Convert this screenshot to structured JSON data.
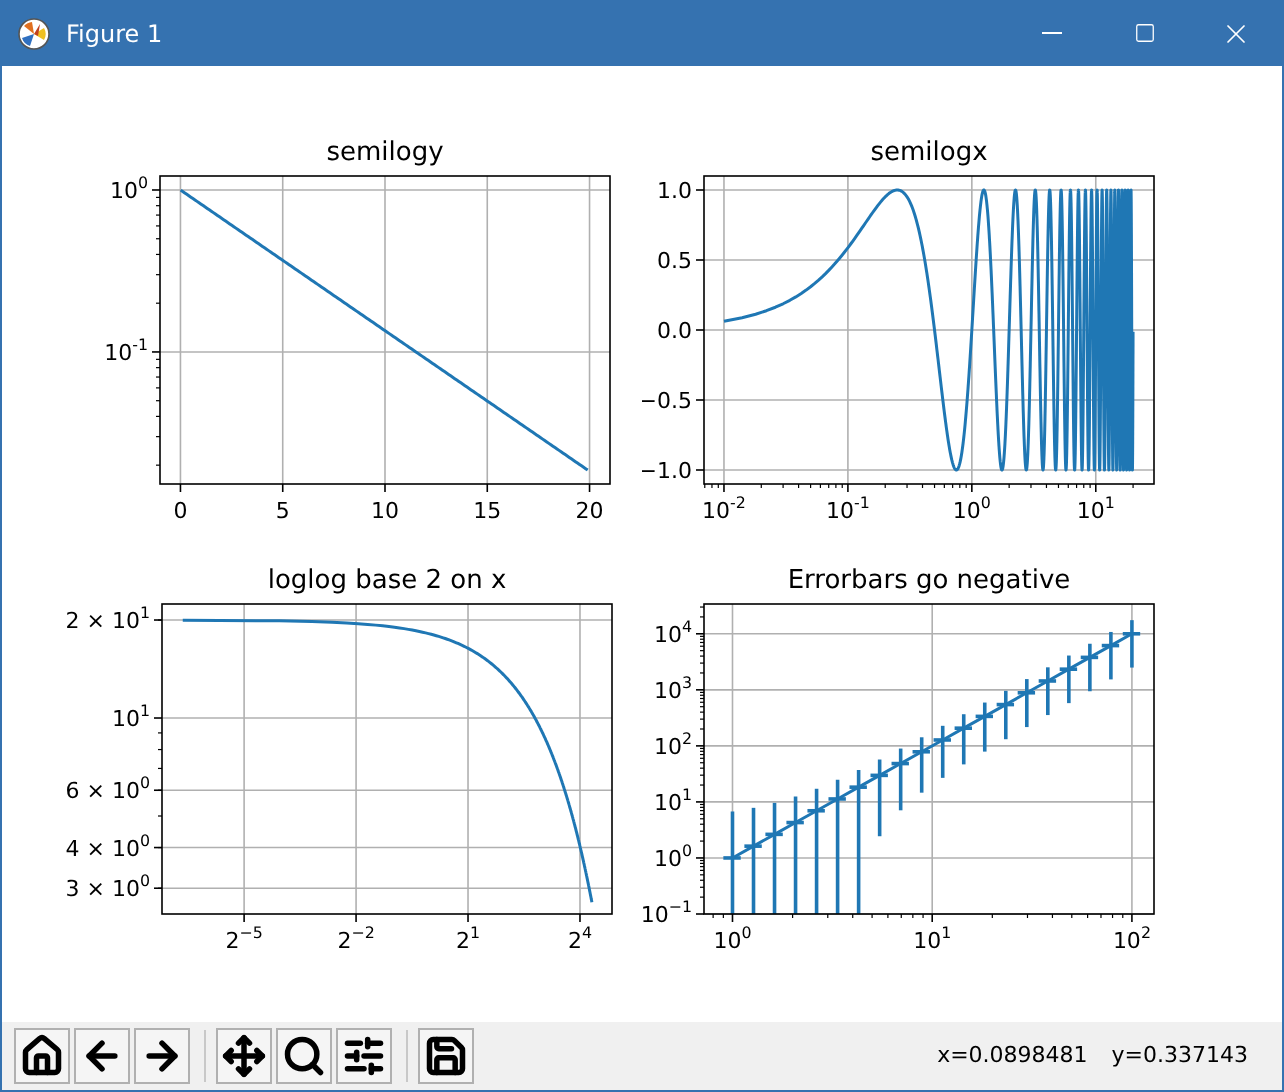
{
  "window": {
    "title": "Figure 1"
  },
  "charts": [
    {
      "title": "semilogy",
      "x_tick_labels": [
        "0",
        "5",
        "10",
        "15",
        "20"
      ],
      "y_tick_labels": [
        "10$^{0}$",
        "10$^{-1}$"
      ]
    },
    {
      "title": "semilogx",
      "x_tick_labels": [
        "10$^{-2}$",
        "10$^{-1}$",
        "10$^{0}$",
        "10$^{1}$"
      ],
      "y_tick_labels": [
        "1.0",
        "0.5",
        "0.0",
        "−0.5",
        "−1.0"
      ]
    },
    {
      "title": "loglog base 2 on x",
      "x_tick_labels": [
        "2$^{−5}$",
        "2$^{−2}$",
        "2$^{1}$",
        "2$^{4}$"
      ],
      "y_tick_labels": [
        "2 × 10$^{1}$",
        "10$^{1}$",
        "6 × 10$^{0}$",
        "4 × 10$^{0}$",
        "3 × 10$^{0}$"
      ]
    },
    {
      "title": "Errorbars go negative",
      "x_tick_labels": [
        "10$^{0}$",
        "10$^{1}$",
        "10$^{2}$"
      ],
      "y_tick_labels": [
        "10$^{4}$",
        "10$^{3}$",
        "10$^{2}$",
        "10$^{1}$",
        "10$^{0}$",
        "10$^{−1}$"
      ]
    }
  ],
  "toolbar": {
    "buttons": [
      {
        "kind": "home"
      },
      {
        "kind": "back"
      },
      {
        "kind": "forward"
      },
      {
        "kind": "separator"
      },
      {
        "kind": "pan"
      },
      {
        "kind": "zoom"
      },
      {
        "kind": "configure"
      },
      {
        "kind": "separator"
      },
      {
        "kind": "save"
      }
    ]
  },
  "status": {
    "x": "x=0.0898481",
    "y": "y=0.337143"
  }
}
